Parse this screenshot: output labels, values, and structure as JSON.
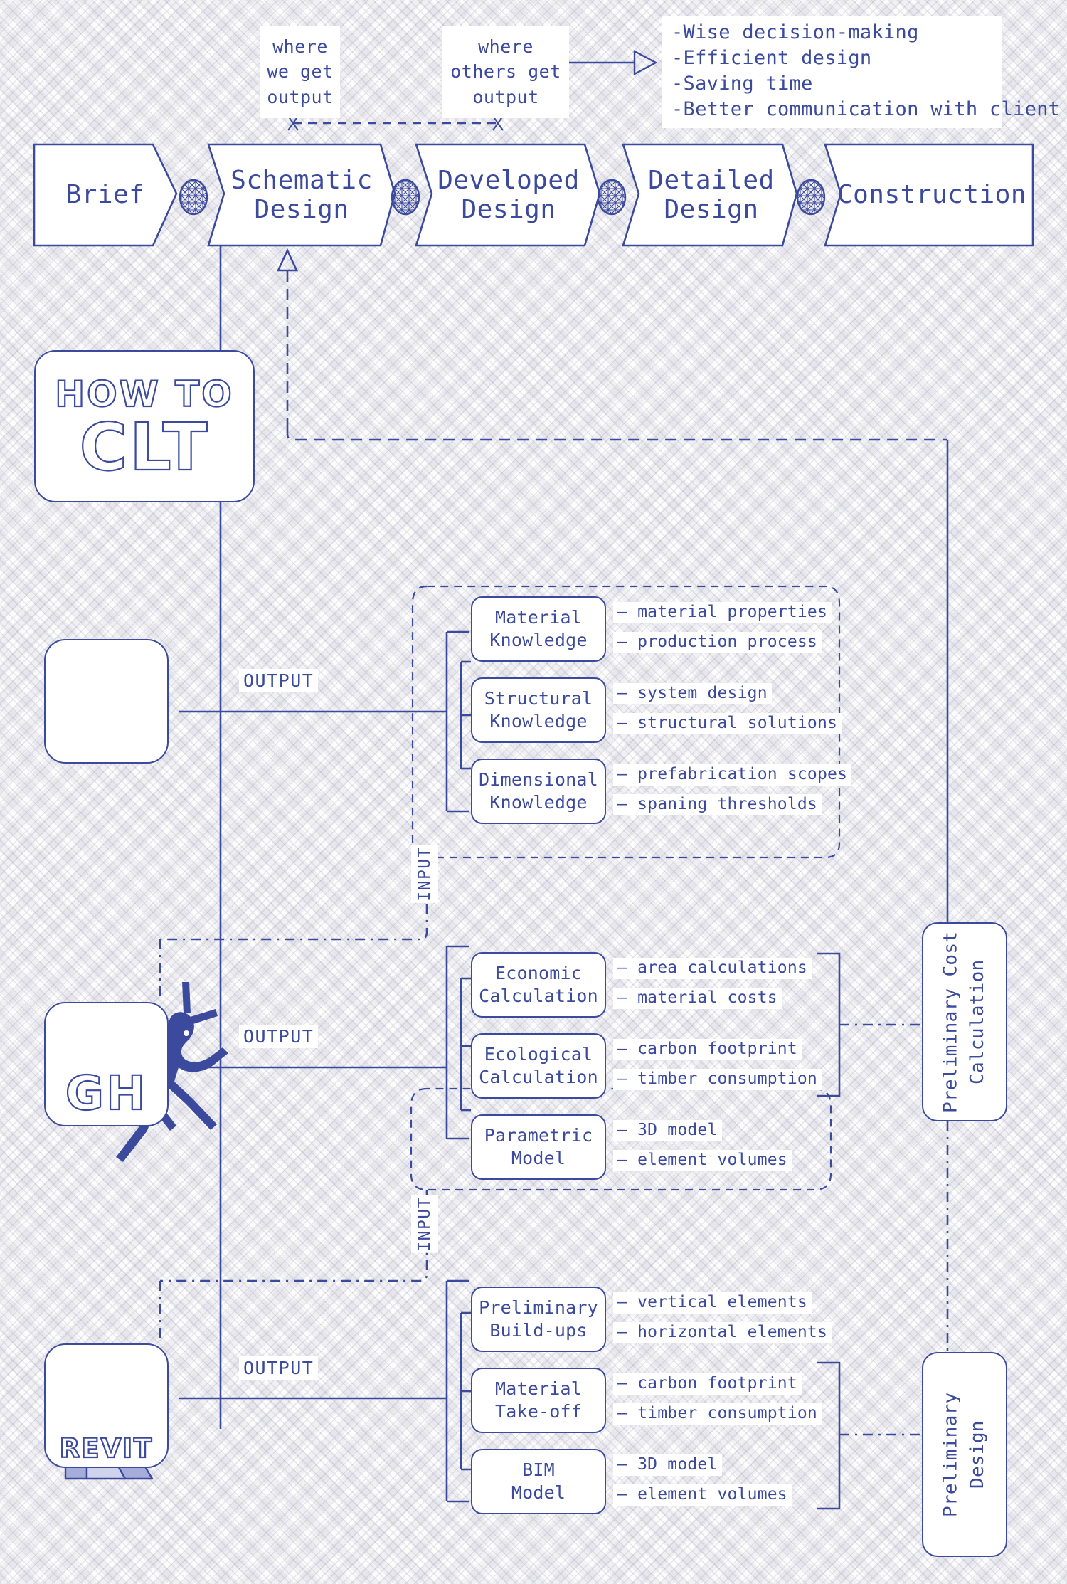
{
  "colors": {
    "ink": "#3b4a9c",
    "lavender": "#a7adda",
    "lavender_light": "#cfd3ec",
    "paper": "#ffffff"
  },
  "annotations": {
    "where_we_get_output": "where\nwe get\noutput",
    "where_others_get_output": "where\nothers get\noutput",
    "benefits": [
      "-Wise decision-making",
      "-Efficient design",
      "-Saving time",
      "-Better communication with client"
    ]
  },
  "stages": [
    {
      "label": "Brief"
    },
    {
      "label": "Schematic\nDesign"
    },
    {
      "label": "Developed\nDesign"
    },
    {
      "label": "Detailed\nDesign"
    },
    {
      "label": "Construction"
    }
  ],
  "logo": {
    "line1": "HOW TO",
    "line2": "CLT"
  },
  "apps": [
    {
      "name": "book",
      "icon": "open-book-icon",
      "label": ""
    },
    {
      "name": "grasshopper",
      "icon": "grasshopper-icon",
      "label": "GH"
    },
    {
      "name": "revit",
      "icon": "revit-r-icon",
      "label": "REVIT"
    }
  ],
  "labels": {
    "output": "OUTPUT",
    "input": "INPUT"
  },
  "groups": [
    {
      "source": "book",
      "output_label": "OUTPUT",
      "input_label": "INPUT",
      "nodes": [
        {
          "title": "Material\nKnowledge",
          "attrs": [
            "material properties",
            "production process"
          ]
        },
        {
          "title": "Structural\nKnowledge",
          "attrs": [
            "system design",
            "structural solutions"
          ]
        },
        {
          "title": "Dimensional\nKnowledge",
          "attrs": [
            "prefabrication scopes",
            "spaning thresholds"
          ]
        }
      ]
    },
    {
      "source": "grasshopper",
      "output_label": "OUTPUT",
      "input_label": "INPUT",
      "nodes": [
        {
          "title": "Economic\nCalculation",
          "attrs": [
            "area calculations",
            "material costs"
          ]
        },
        {
          "title": "Ecological\nCalculation",
          "attrs": [
            "carbon footprint",
            "timber consumption"
          ]
        },
        {
          "title": "Parametric\nModel",
          "attrs": [
            "3D model",
            "element volumes"
          ]
        }
      ]
    },
    {
      "source": "revit",
      "output_label": "OUTPUT",
      "nodes": [
        {
          "title": "Preliminary\nBuild-ups",
          "attrs": [
            "vertical elements",
            "horizontal elements"
          ]
        },
        {
          "title": "Material\nTake-off",
          "attrs": [
            "carbon footprint",
            "timber consumption"
          ]
        },
        {
          "title": "BIM\nModel",
          "attrs": [
            "3D model",
            "element volumes"
          ]
        }
      ]
    }
  ],
  "results": [
    {
      "label": "Preliminary Cost\nCalculation"
    },
    {
      "label": "Preliminary\nDesign"
    }
  ]
}
